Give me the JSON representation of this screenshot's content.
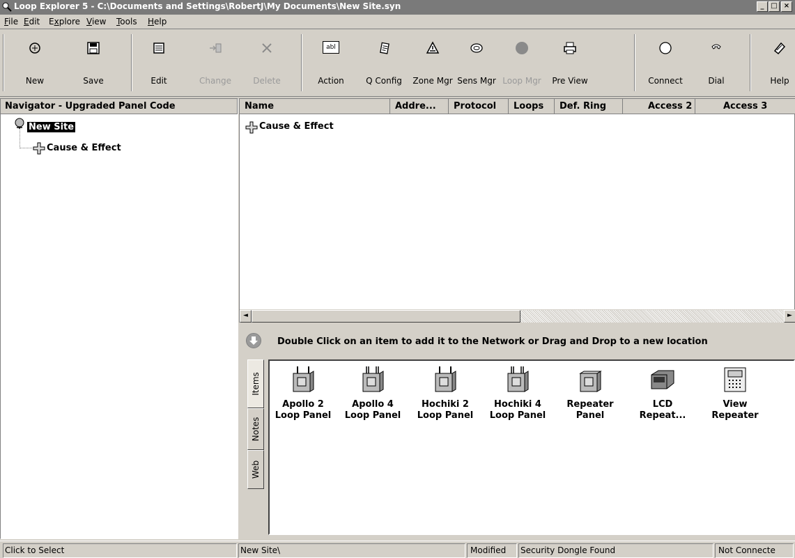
{
  "window": {
    "title": "Loop Explorer 5 - C:\\Documents and Settings\\RobertJ\\My Documents\\New Site.syn",
    "buttons": {
      "minimize": "_",
      "maximize": "□",
      "close": "×"
    }
  },
  "menu": [
    {
      "label": "File",
      "mnemonic": "F",
      "rest": "ile"
    },
    {
      "label": "Edit",
      "mnemonic": "E",
      "rest": "dit"
    },
    {
      "label": "Explore",
      "mnemonic": "x",
      "pre": "E",
      "rest": "plore"
    },
    {
      "label": "View",
      "mnemonic": "V",
      "rest": "iew"
    },
    {
      "label": "Tools",
      "mnemonic": "T",
      "rest": "ools"
    },
    {
      "label": "Help",
      "mnemonic": "H",
      "rest": "elp"
    }
  ],
  "toolbar": {
    "new": "New",
    "save": "Save",
    "edit": "Edit",
    "change": "Change",
    "delete": "Delete",
    "action": "Action",
    "action_icon_text": "abl",
    "qconfig": "Q Config",
    "zonemgr": "Zone Mgr",
    "sensmgr": "Sens Mgr",
    "loopmgr": "Loop Mgr",
    "preview": "Pre View",
    "connect": "Connect",
    "dial": "Dial",
    "help": "Help"
  },
  "navigator": {
    "title": "Navigator - Upgraded Panel Code",
    "root": "New Site",
    "child": "Cause & Effect"
  },
  "list": {
    "columns": [
      "Name",
      "Addre...",
      "Protocol",
      "Loops",
      "Def. Ring",
      "Access 2",
      "Access 3"
    ],
    "rows": [
      {
        "name": "Cause & Effect"
      }
    ]
  },
  "scroll": {
    "left": "◄",
    "right": "►"
  },
  "palette": {
    "hint": "Double Click on an item to add it to the Network or Drag and Drop to a new location",
    "tabs": [
      "Items",
      "Notes",
      "Web"
    ],
    "items": [
      {
        "label": "Apollo 2\nLoop Panel",
        "icon": "panel-icon"
      },
      {
        "label": "Apollo 4\nLoop Panel",
        "icon": "panel-icon"
      },
      {
        "label": "Hochiki 2\nLoop Panel",
        "icon": "panel-icon"
      },
      {
        "label": "Hochiki 4\nLoop Panel",
        "icon": "panel-icon"
      },
      {
        "label": "Repeater\nPanel",
        "icon": "panel-icon"
      },
      {
        "label": "LCD\nRepeat...",
        "icon": "lcd-repeater-icon"
      },
      {
        "label": "View\nRepeater",
        "icon": "view-repeater-icon"
      }
    ]
  },
  "status": {
    "hint": "Click to Select",
    "path": "New Site\\",
    "modified": "Modified",
    "dongle": "Security Dongle Found",
    "connection": "Not Connecte"
  }
}
